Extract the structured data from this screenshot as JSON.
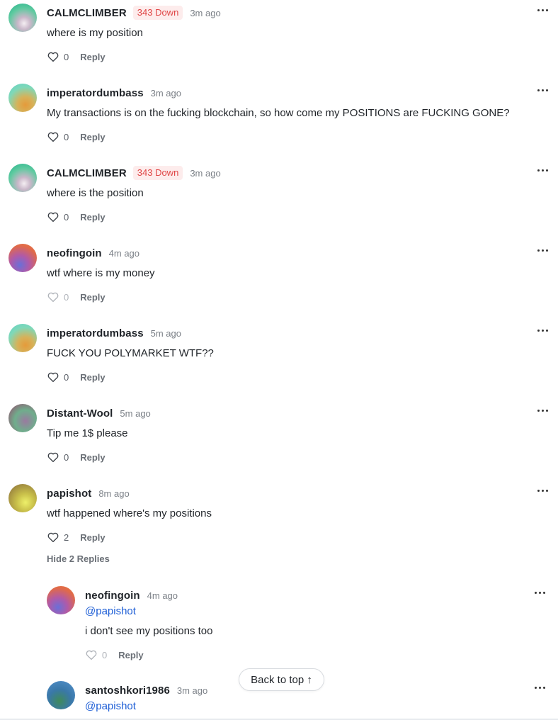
{
  "comments": [
    {
      "author": "CALMCLIMBER",
      "badge": "343 Down",
      "time": "3m ago",
      "text": "where is my position",
      "likes": "0",
      "reply_label": "Reply"
    },
    {
      "author": "imperatordumbass",
      "badge": "",
      "time": "3m ago",
      "text": "My transactions is on the fucking blockchain, so how come my POSITIONS are FUCKING GONE?",
      "likes": "0",
      "reply_label": "Reply"
    },
    {
      "author": "CALMCLIMBER",
      "badge": "343 Down",
      "time": "3m ago",
      "text": "where is the position",
      "likes": "0",
      "reply_label": "Reply"
    },
    {
      "author": "neofingoin",
      "badge": "",
      "time": "4m ago",
      "text": "wtf where is my money",
      "likes": "0",
      "reply_label": "Reply"
    },
    {
      "author": "imperatordumbass",
      "badge": "",
      "time": "5m ago",
      "text": "FUCK YOU POLYMARKET WTF??",
      "likes": "0",
      "reply_label": "Reply"
    },
    {
      "author": "Distant-Wool",
      "badge": "",
      "time": "5m ago",
      "text": "Tip me 1$ please",
      "likes": "0",
      "reply_label": "Reply"
    },
    {
      "author": "papishot",
      "badge": "",
      "time": "8m ago",
      "text": "wtf happened where's my positions",
      "likes": "2",
      "reply_label": "Reply"
    }
  ],
  "hide_replies_label": "Hide 2 Replies",
  "replies": [
    {
      "author": "neofingoin",
      "time": "4m ago",
      "mention": "@papishot",
      "text": "i don't see my positions too",
      "likes": "0",
      "reply_label": "Reply"
    },
    {
      "author": "santoshkori1986",
      "time": "3m ago",
      "mention": "@papishot"
    }
  ],
  "back_to_top_label": "Back to top ↑",
  "colors": {
    "badge_text": "#e04545",
    "badge_bg": "#fdecec",
    "mention": "#1f5fd6"
  },
  "icons": {
    "like": "heart-icon",
    "more": "more-options-icon"
  }
}
